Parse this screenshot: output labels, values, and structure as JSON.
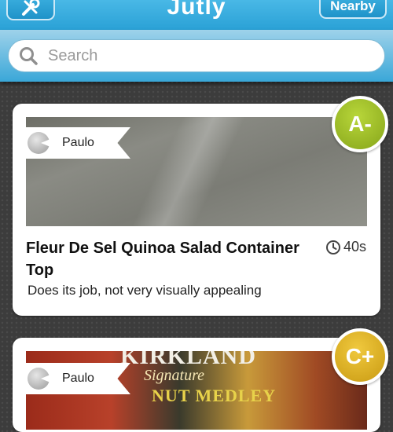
{
  "app": {
    "title": "Jutly"
  },
  "header": {
    "nearby_label": "Nearby",
    "tool_icon": "tools-icon"
  },
  "search": {
    "placeholder": "Search",
    "value": ""
  },
  "items": [
    {
      "user": "Paulo",
      "grade": "A-",
      "title": "Fleur De Sel Quinoa Salad Container Top",
      "time": "40s",
      "description": "Does its job, not very visually appealing",
      "grade_color": "#9bbd24"
    },
    {
      "user": "Paulo",
      "grade": "C+",
      "photo_text": [
        "KIRKLAND",
        "Signature",
        "NUT MEDLEY"
      ],
      "grade_color": "#e4b52a"
    }
  ],
  "colors": {
    "header": "#2aa1d6",
    "background": "#3c3c3c"
  }
}
